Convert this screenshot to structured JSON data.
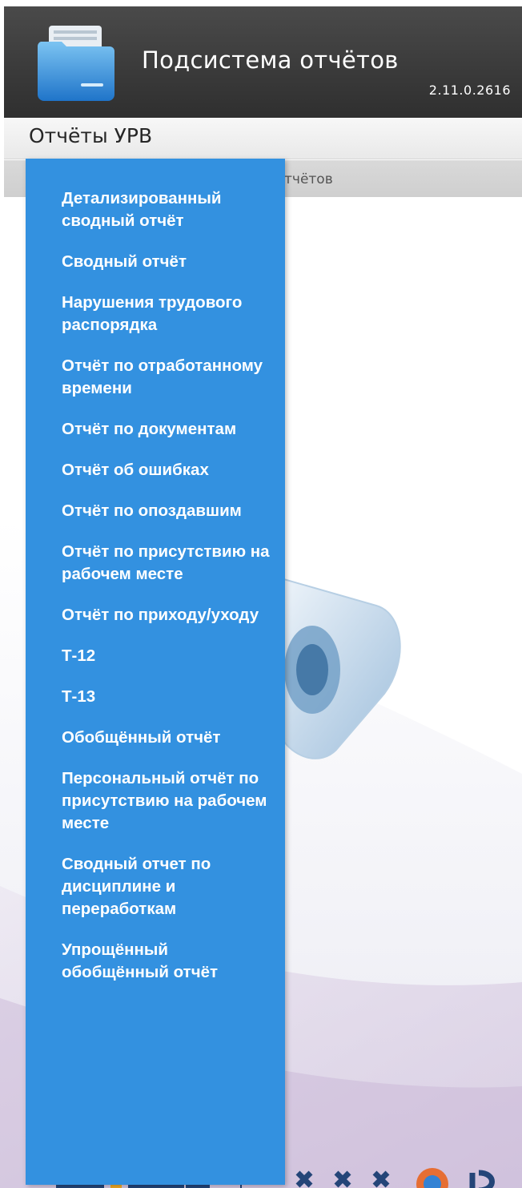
{
  "header": {
    "title": "Подсистема отчётов",
    "version": "2.11.0.2616",
    "icon": "folder-icon"
  },
  "menubar": {
    "active_menu": "Отчёты УРВ"
  },
  "subbar": {
    "text_visible": "тчётов"
  },
  "dropdown": {
    "items": [
      {
        "label": "Детализированный сводный отчёт"
      },
      {
        "label": "Сводный отчёт"
      },
      {
        "label": "Нарушения трудового распорядка"
      },
      {
        "label": "Отчёт по отработанному времени"
      },
      {
        "label": "Отчёт по документам"
      },
      {
        "label": "Отчёт об ошибках"
      },
      {
        "label": "Отчёт по опоздавшим"
      },
      {
        "label": "Отчёт по присутствию на рабочем месте"
      },
      {
        "label": "Отчёт по приходу/уходу"
      },
      {
        "label": "Т-12"
      },
      {
        "label": "Т-13"
      },
      {
        "label": "Обобщённый отчёт"
      },
      {
        "label": "Персональный отчёт по присутствию на рабочем месте"
      },
      {
        "label": "Сводный отчет по дисциплине и переработкам"
      },
      {
        "label": "Упрощённый обобщённый отчёт"
      }
    ]
  },
  "colors": {
    "header_bg": "#3a3a3a",
    "dropdown_bg": "#3391e0",
    "menubar_bg": "#eeeeee"
  }
}
